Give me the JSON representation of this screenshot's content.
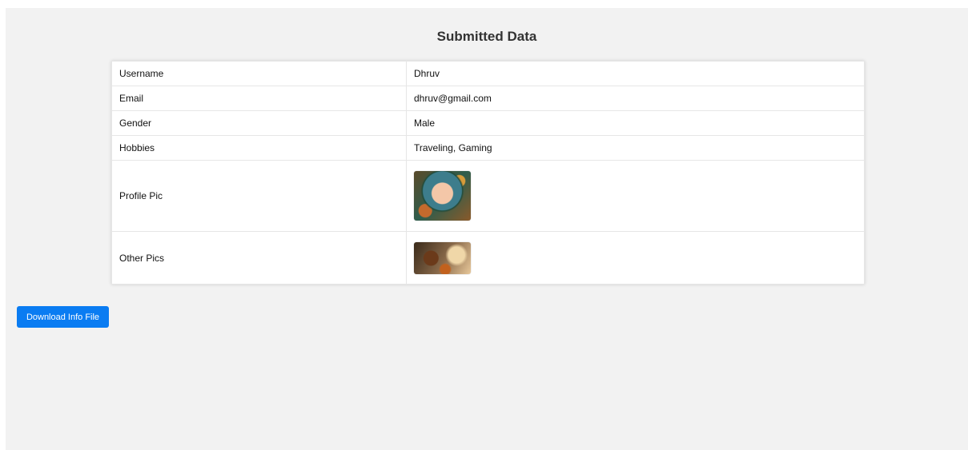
{
  "page": {
    "title": "Submitted Data"
  },
  "table": {
    "rows": [
      {
        "label": "Username",
        "value": "Dhruv"
      },
      {
        "label": "Email",
        "value": "dhruv@gmail.com"
      },
      {
        "label": "Gender",
        "value": "Male"
      },
      {
        "label": "Hobbies",
        "value": "Traveling, Gaming"
      },
      {
        "label": "Profile Pic"
      },
      {
        "label": "Other Pics"
      }
    ]
  },
  "actions": {
    "download_label": "Download Info File"
  },
  "colors": {
    "button_bg": "#0a7cf2",
    "page_bg": "#f2f2f2"
  }
}
